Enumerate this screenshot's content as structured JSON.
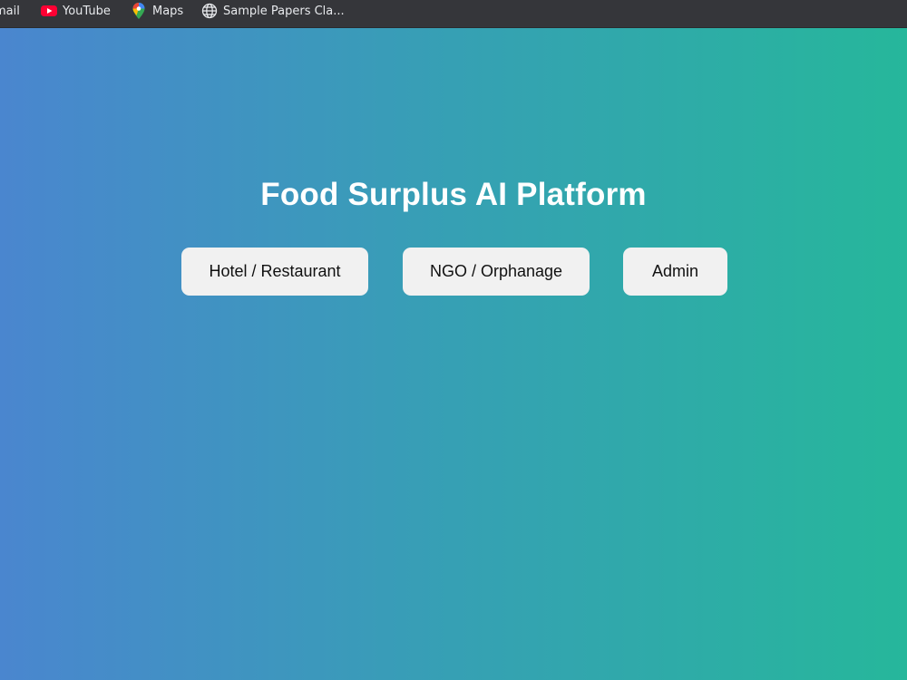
{
  "bookmarks": [
    {
      "label": "mail",
      "icon": "mail-icon"
    },
    {
      "label": "YouTube",
      "icon": "youtube-icon"
    },
    {
      "label": "Maps",
      "icon": "maps-icon"
    },
    {
      "label": "Sample Papers Cla...",
      "icon": "globe-icon"
    }
  ],
  "page": {
    "title": "Food Surplus AI Platform",
    "buttons": {
      "hotel": "Hotel / Restaurant",
      "ngo": "NGO / Orphanage",
      "admin": "Admin"
    }
  },
  "colors": {
    "gradient_start": "#4a86cf",
    "gradient_end": "#26b79b",
    "button_bg": "#f1f1f1",
    "title": "#ffffff"
  }
}
